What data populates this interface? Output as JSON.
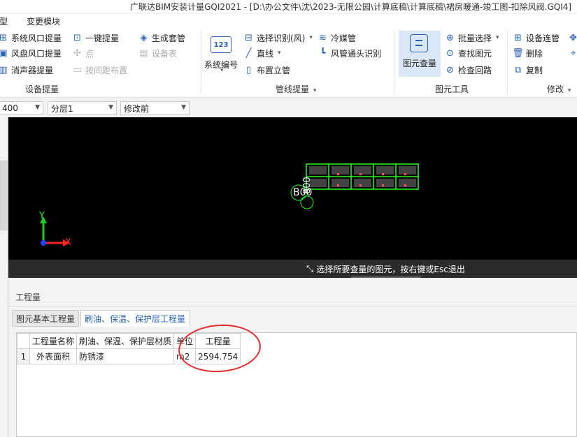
{
  "window": {
    "title": "广联达BIM安装计量GQI2021 - [D:\\办公文件\\沈\\2023-无限公园\\计算底稿\\计算底稿\\裙房暖通-竣工图-扣除风阀.GQI4]"
  },
  "menu": {
    "items": [
      "型",
      "变更模块"
    ]
  },
  "ribbon": {
    "groups": [
      {
        "label": "设备提量",
        "buttons": [
          {
            "label": "系统风口提量",
            "icon": "air-outlet-icon"
          },
          {
            "label": "一键提量",
            "icon": "plus-box-icon"
          },
          {
            "label": "生成套管",
            "icon": "sleeve-icon"
          },
          {
            "label": "风盘风口提量",
            "icon": "fan-coil-icon"
          },
          {
            "label": "点",
            "icon": "point-icon",
            "disabled": true
          },
          {
            "label": "设备表",
            "icon": "table-icon",
            "disabled": true
          },
          {
            "label": "消声器提量",
            "icon": "muffler-icon"
          },
          {
            "label": "按间距布置",
            "icon": "spacing-icon",
            "disabled": true
          }
        ]
      },
      {
        "label": "管线提量",
        "big": {
          "label": "系统编号",
          "badge": "123"
        },
        "buttons": [
          {
            "label": "选择识别(风)",
            "icon": "select-recognize-icon"
          },
          {
            "label": "冷媒管",
            "icon": "refrigerant-pipe-icon"
          },
          {
            "label": "直线",
            "icon": "line-icon"
          },
          {
            "label": "风管通头识别",
            "icon": "duct-fitting-icon"
          },
          {
            "label": "布置立管",
            "icon": "riser-icon"
          }
        ]
      },
      {
        "label": "图元工具",
        "big": {
          "label": "图元查量"
        },
        "buttons": [
          {
            "label": "批量选择",
            "icon": "batch-select-icon"
          },
          {
            "label": "查找图元",
            "icon": "find-element-icon"
          },
          {
            "label": "检查回路",
            "icon": "check-loop-icon"
          }
        ]
      },
      {
        "label": "修改",
        "buttons": [
          {
            "label": "设备连管",
            "icon": "device-connect-icon"
          },
          {
            "label": "删除",
            "icon": "trash-icon"
          },
          {
            "label": "复制",
            "icon": "copy-icon"
          }
        ]
      }
    ]
  },
  "propbar": {
    "floor": "400",
    "layer": "分层1",
    "stage": "修改前"
  },
  "viewport": {
    "status_msg": "选择所要查量的图元，按右键或Esc退出",
    "axis_x": "X",
    "axis_y": "Y",
    "marker_text": "B00",
    "marker_text2": "800"
  },
  "panel": {
    "title": "工程量",
    "tabs": [
      "图元基本工程量",
      "刷油、保温、保护层工程量"
    ],
    "active_tab": 1,
    "table": {
      "headers": [
        "",
        "工程量名称",
        "刷油、保温、保护层材质",
        "单位",
        "工程量"
      ],
      "rows": [
        [
          "1",
          "外表面积",
          "防锈漆",
          "m2",
          "2594.754"
        ]
      ]
    }
  },
  "colors": {
    "accent": "#2a63b5",
    "highlight_bg": "#d9e7f7",
    "annotation_circle": "#e52b2b",
    "cad_green": "#22ff22"
  }
}
